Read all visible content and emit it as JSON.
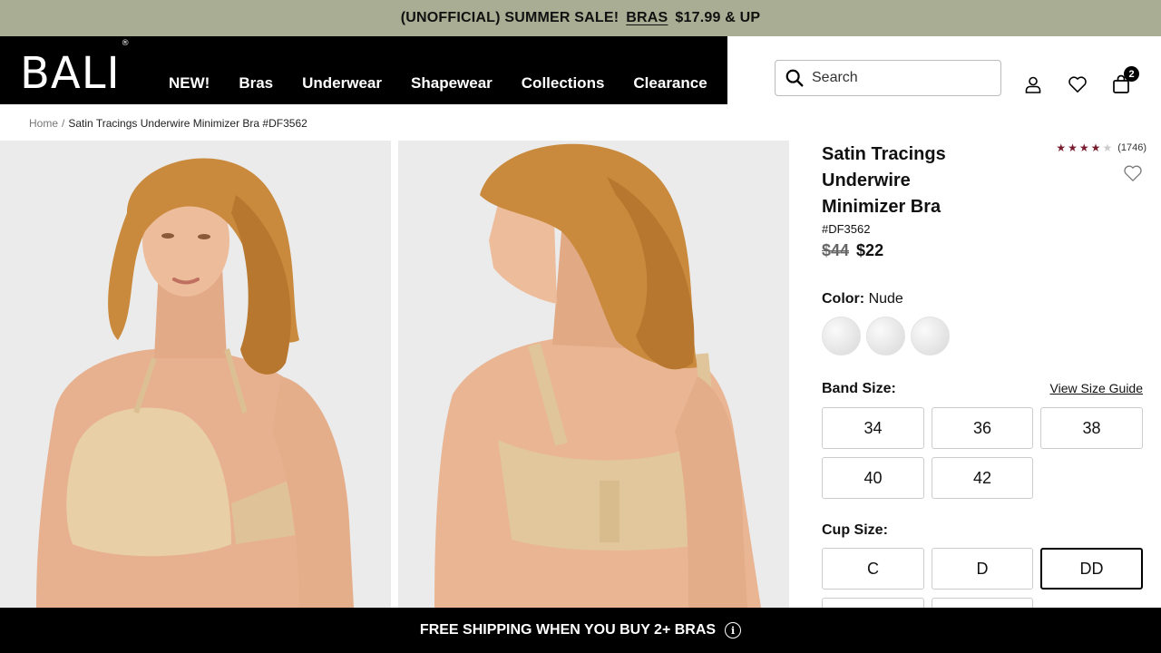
{
  "promo": {
    "text": "(UNOFFICIAL) SUMMER SALE!",
    "link": "BRAS",
    "price_text": "$17.99 & UP"
  },
  "header": {
    "logo": "BALI",
    "logo_mark": "®",
    "nav": [
      "NEW!",
      "Bras",
      "Underwear",
      "Shapewear",
      "Collections",
      "Clearance"
    ],
    "search_placeholder": "Search",
    "cart_count": "2"
  },
  "breadcrumb": {
    "home": "Home",
    "separator": "/",
    "current": "Satin Tracings Underwire Minimizer Bra #DF3562"
  },
  "product": {
    "title": "Satin Tracings Underwire Minimizer Bra",
    "sku": "#DF3562",
    "price_original": "$44",
    "price_sale": "$22",
    "rating_stars": 4,
    "rating_count": "(1746)",
    "color_label": "Color:",
    "color_value": "Nude",
    "band_label": "Band Size:",
    "size_guide": "View Size Guide",
    "band_sizes": [
      "34",
      "36",
      "38",
      "40",
      "42"
    ],
    "cup_label": "Cup Size:",
    "cup_sizes": [
      "C",
      "D",
      "DD"
    ],
    "selected_cup": "DD"
  },
  "footer_bar": {
    "text": "FREE SHIPPING WHEN YOU BUY 2+ BRAS",
    "info_icon": "info-icon"
  },
  "colors": {
    "promo_bg": "#a9ad93",
    "nav_bg": "#000000",
    "star": "#7a1c30"
  }
}
